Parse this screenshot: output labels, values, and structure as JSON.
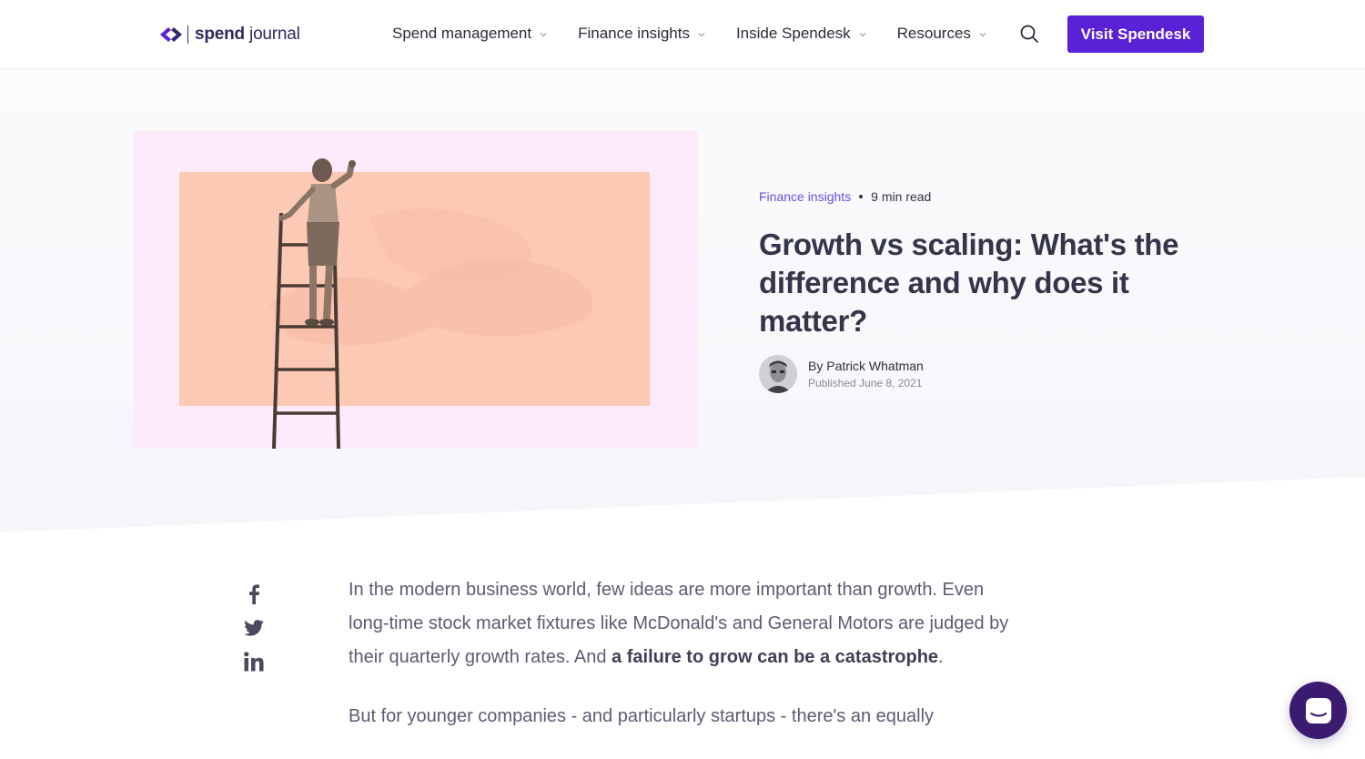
{
  "header": {
    "logo_strong": "spend",
    "logo_light": "journal",
    "nav": [
      {
        "label": "Spend management"
      },
      {
        "label": "Finance insights"
      },
      {
        "label": "Inside Spendesk"
      },
      {
        "label": "Resources"
      }
    ],
    "cta_label": "Visit Spendesk"
  },
  "hero": {
    "category": "Finance insights",
    "read_time": "9 min read",
    "title": "Growth vs scaling: What's the difference and why does it matter?",
    "author": "By Patrick Whatman",
    "published": "Published June 8, 2021"
  },
  "article": {
    "p1_a": "In the modern business world, few ideas are more important than growth. Even long-time stock market fixtures like McDonald's and General Motors are judged by their quarterly growth rates. And ",
    "p1_strong": "a failure to grow can be a catastrophe",
    "p1_b": ".",
    "p2": "But for younger companies - and particularly startups - there's an equally"
  },
  "icons": {
    "logo": "spendesk-logo-icon",
    "search": "search-icon",
    "facebook": "facebook-icon",
    "twitter": "twitter-icon",
    "linkedin": "linkedin-icon",
    "chat": "chat-icon"
  },
  "colors": {
    "brand": "#5a22d6",
    "category_link": "#6b4fe6",
    "hero_image_bg": "#fcecfb",
    "hero_image_rect": "#fcc9b4",
    "chat_bubble": "#3a1b6f"
  }
}
